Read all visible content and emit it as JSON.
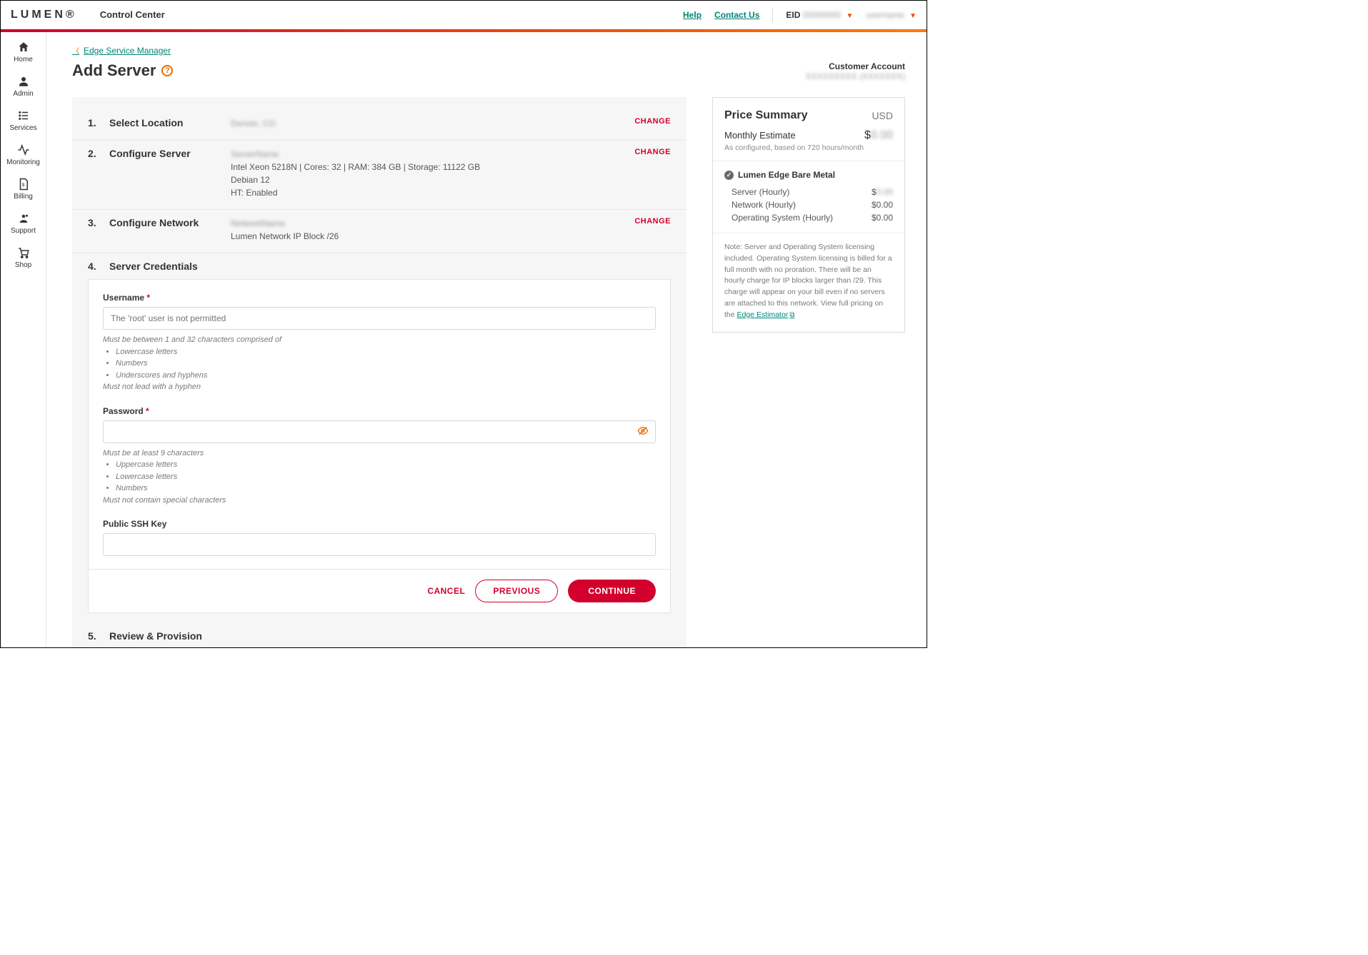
{
  "header": {
    "logo": "LUMEN",
    "app_title": "Control Center",
    "help": "Help",
    "contact": "Contact Us",
    "eid_label": "EID"
  },
  "sidebar": {
    "items": [
      {
        "label": "Home"
      },
      {
        "label": "Admin"
      },
      {
        "label": "Services"
      },
      {
        "label": "Monitoring"
      },
      {
        "label": "Billing"
      },
      {
        "label": "Support"
      },
      {
        "label": "Shop"
      }
    ]
  },
  "breadcrumb": {
    "label": "Edge Service Manager"
  },
  "page": {
    "title": "Add Server"
  },
  "customer": {
    "label": "Customer Account"
  },
  "steps": {
    "s1": {
      "num": "1.",
      "title": "Select Location",
      "change": "CHANGE"
    },
    "s2": {
      "num": "2.",
      "title": "Configure Server",
      "line2": "Intel Xeon 5218N | Cores: 32 | RAM: 384 GB | Storage: 11122 GB",
      "line3": "Debian 12",
      "line4": "HT: Enabled",
      "change": "CHANGE"
    },
    "s3": {
      "num": "3.",
      "title": "Configure Network",
      "line2": "Lumen Network IP Block /26",
      "change": "CHANGE"
    },
    "s4": {
      "num": "4.",
      "title": "Server Credentials"
    },
    "s5": {
      "num": "5.",
      "title": "Review & Provision"
    }
  },
  "credentials": {
    "username_label": "Username",
    "username_placeholder": "The 'root' user is not permitted",
    "username_hint_lead": "Must be between 1 and 32 characters comprised of",
    "username_hint_b1": "Lowercase letters",
    "username_hint_b2": "Numbers",
    "username_hint_b3": "Underscores and hyphens",
    "username_hint_tail": "Must not lead with a hyphen",
    "password_label": "Password",
    "password_hint_lead": "Must be at least 9 characters",
    "password_hint_b1": "Uppercase letters",
    "password_hint_b2": "Lowercase letters",
    "password_hint_b3": "Numbers",
    "password_hint_tail": "Must not contain special characters",
    "ssh_label": "Public SSH Key"
  },
  "actions": {
    "cancel": "CANCEL",
    "previous": "PREVIOUS",
    "continue": "CONTINUE"
  },
  "price": {
    "title": "Price Summary",
    "currency": "USD",
    "monthly_label": "Monthly Estimate",
    "monthly_prefix": "$",
    "monthly_sub": "As configured, based on 720 hours/month",
    "product": "Lumen Edge Bare Metal",
    "line1_label": "Server (Hourly)",
    "line1_value": "$",
    "line2_label": "Network (Hourly)",
    "line2_value": "$0.00",
    "line3_label": "Operating System (Hourly)",
    "line3_value": "$0.00",
    "note": "Note: Server and Operating System licensing included. Operating System licensing is billed for a full month with no proration. There will be an hourly charge for IP blocks larger than /29. This charge will appear on your bill even if no servers are attached to this network. View full pricing on the ",
    "note_link": "Edge Estimator"
  }
}
